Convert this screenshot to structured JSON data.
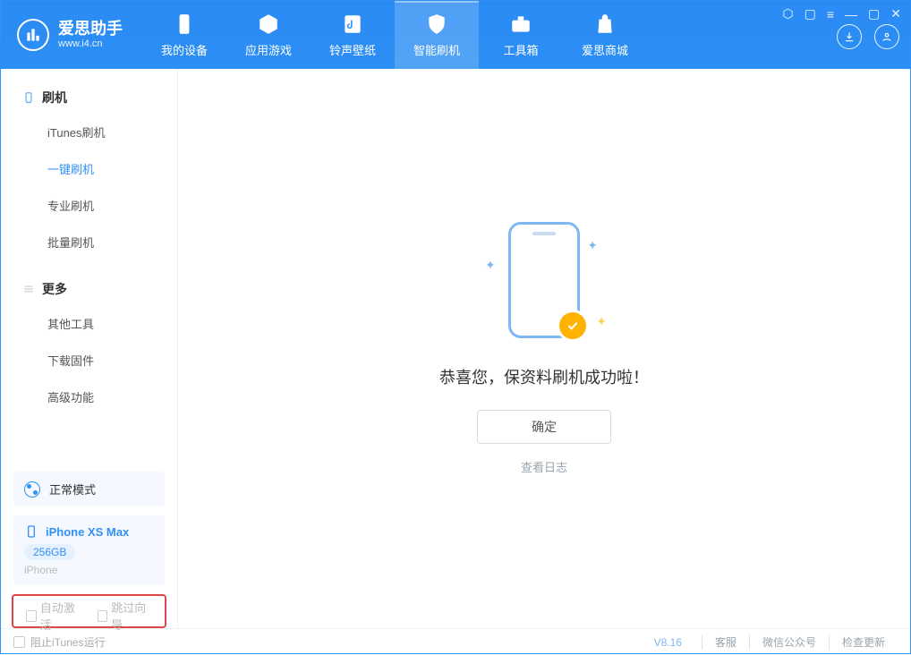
{
  "app": {
    "name": "爱思助手",
    "url": "www.i4.cn"
  },
  "nav": {
    "device": "我的设备",
    "apps": "应用游戏",
    "ring": "铃声壁纸",
    "flash": "智能刷机",
    "tool": "工具箱",
    "mall": "爱思商城"
  },
  "sidebar": {
    "head_flash": "刷机",
    "itunes": "iTunes刷机",
    "oneclick": "一键刷机",
    "pro": "专业刷机",
    "batch": "批量刷机",
    "head_more": "更多",
    "other": "其他工具",
    "firmware": "下载固件",
    "advanced": "高级功能"
  },
  "mode": {
    "label": "正常模式"
  },
  "device": {
    "name": "iPhone XS Max",
    "capacity": "256GB",
    "type": "iPhone"
  },
  "opts": {
    "auto_activate": "自动激活",
    "skip_guide": "跳过向导"
  },
  "result": {
    "message": "恭喜您，保资料刷机成功啦！",
    "ok": "确定",
    "view_log": "查看日志"
  },
  "footer": {
    "block_itunes": "阻止iTunes运行",
    "version": "V8.16",
    "support": "客服",
    "wechat": "微信公众号",
    "update": "检查更新"
  }
}
